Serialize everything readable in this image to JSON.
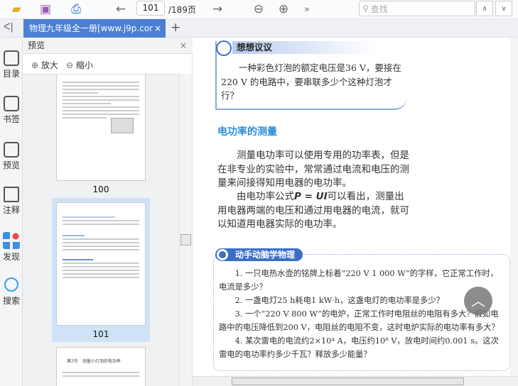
{
  "toolbar": {
    "page_current": "101",
    "page_total": "/189页",
    "more": "»",
    "search_placeholder": "查找"
  },
  "tabs": {
    "collapse": "ᐸ|",
    "active_tab": "物理九年级全一册[www.j9p.cor",
    "close": "×",
    "add": "+"
  },
  "rail": {
    "items": [
      {
        "label": "目录"
      },
      {
        "label": "书签"
      },
      {
        "label": "预览"
      },
      {
        "label": "注释"
      },
      {
        "label": "发现"
      },
      {
        "label": "搜索"
      }
    ]
  },
  "preview": {
    "title": "预览",
    "close": "×",
    "zoom_in": "放大",
    "zoom_out": "缩小",
    "pages": [
      {
        "label": "100"
      },
      {
        "label": "101"
      },
      {
        "label": "第3节　测量小灯泡的电功率"
      }
    ]
  },
  "document": {
    "think_title": "想想议议",
    "think_text": "一种彩色灯泡的额定电压是36 V，要接在220 V 的电路中，要串联多少个这种灯泡才行？",
    "heading": "电功率的测量",
    "para1": "测量电功率可以使用专用的功率表，但是在非专业的实验中，常常通过电流和电压的测量来间接得知用电器的电功率。",
    "para2_pre": "由电功率公式",
    "para2_formula": "P = UI",
    "para2_post": "可以看出，测量出用电器两端的电压和通过用电器的电流，就可以知道用电器实际的电功率。",
    "activity_title": "动手动脑学物理",
    "questions": [
      "1. 一只电热水壶的铭牌上标着“220 V  1 000 W”的字样，它正常工作时，电流是多少？",
      "2. 一盏电灯25 h耗电1 kW·h，这盏电灯的电功率是多少？",
      "3. 一个“220 V  800 W”的电炉，正常工作时电阻丝的电阻有多大？假如电路中的电压降低到200 V，电阻丝的电阻不变，这时电炉实际的电功率有多大？",
      "4. 某次雷电的电流约2×10⁴ A，电压约10⁸ V，放电时间约0.001 s。这次雷电的电功率约多少千瓦？释放多少能量？"
    ]
  },
  "colors": {
    "accent": "#4a7fd4",
    "heading": "#2d8fd5",
    "selected": "#cfe3f7"
  }
}
